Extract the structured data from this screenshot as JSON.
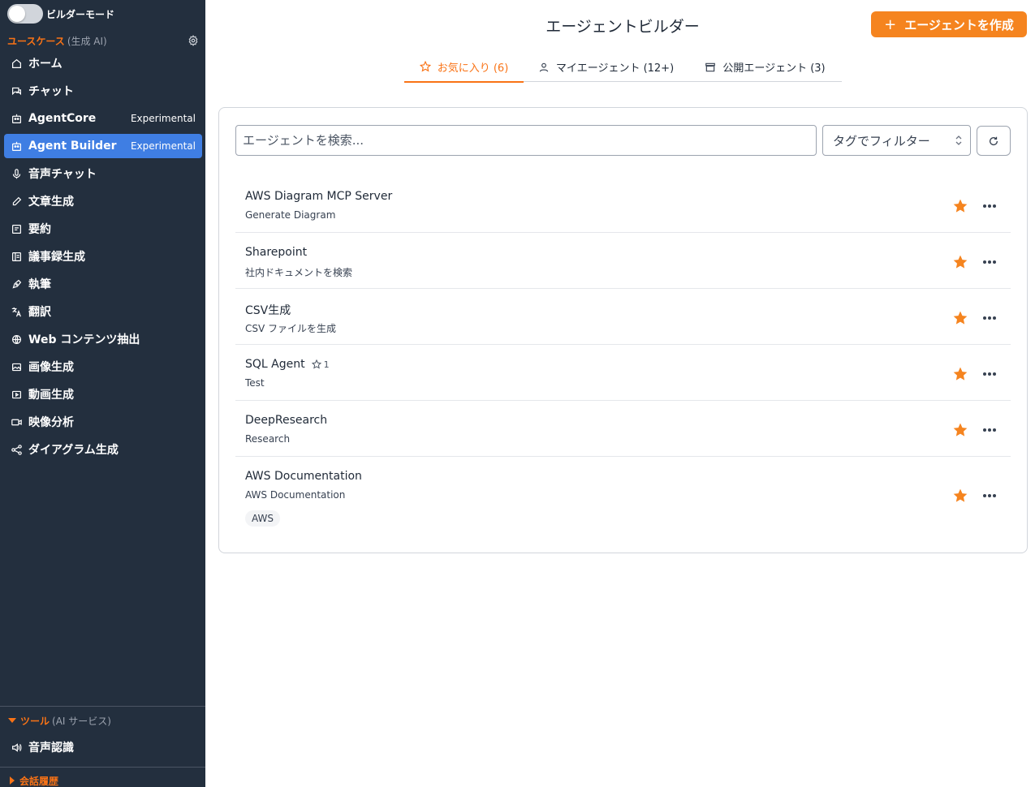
{
  "sidebar": {
    "builder_mode_label": "ビルダーモード",
    "usecase_title": "ユースケース",
    "usecase_sub": "(生成 AI)",
    "items": [
      {
        "label": "ホーム",
        "icon": "home-icon",
        "badge": ""
      },
      {
        "label": "チャット",
        "icon": "chat-icon",
        "badge": ""
      },
      {
        "label": "AgentCore",
        "icon": "robot-icon",
        "badge": "Experimental"
      },
      {
        "label": "Agent Builder",
        "icon": "robot-icon",
        "badge": "Experimental"
      },
      {
        "label": "音声チャット",
        "icon": "microphone-icon",
        "badge": ""
      },
      {
        "label": "文章生成",
        "icon": "pencil-icon",
        "badge": ""
      },
      {
        "label": "要約",
        "icon": "summary-icon",
        "badge": ""
      },
      {
        "label": "議事録生成",
        "icon": "minutes-icon",
        "badge": ""
      },
      {
        "label": "執筆",
        "icon": "pen-icon",
        "badge": ""
      },
      {
        "label": "翻訳",
        "icon": "translate-icon",
        "badge": ""
      },
      {
        "label": "Web コンテンツ抽出",
        "icon": "globe-icon",
        "badge": ""
      },
      {
        "label": "画像生成",
        "icon": "image-icon",
        "badge": ""
      },
      {
        "label": "動画生成",
        "icon": "video-play-icon",
        "badge": ""
      },
      {
        "label": "映像分析",
        "icon": "camera-icon",
        "badge": ""
      },
      {
        "label": "ダイアグラム生成",
        "icon": "diagram-icon",
        "badge": ""
      }
    ],
    "tools_title": "ツール",
    "tools_sub": "(AI サービス)",
    "tools_items": [
      {
        "label": "音声認識",
        "icon": "speaker-icon"
      }
    ],
    "history_title": "会話履歴"
  },
  "header": {
    "title": "エージェントビルダー",
    "create_label": "エージェントを作成"
  },
  "tabs": [
    {
      "label": "お気に入り (6)",
      "icon": "star-outline-icon"
    },
    {
      "label": "マイエージェント (12+)",
      "icon": "user-icon"
    },
    {
      "label": "公開エージェント (3)",
      "icon": "store-icon"
    }
  ],
  "search": {
    "placeholder": "エージェントを検索...",
    "value": ""
  },
  "filter": {
    "selected": "タグでフィルター"
  },
  "agents": [
    {
      "name": "AWS Diagram MCP Server",
      "description": "Generate Diagram",
      "stars": "",
      "tag": ""
    },
    {
      "name": "Sharepoint",
      "description": "社内ドキュメントを検索",
      "stars": "",
      "tag": ""
    },
    {
      "name": "CSV生成",
      "description": "CSV ファイルを生成",
      "stars": "",
      "tag": ""
    },
    {
      "name": "SQL Agent",
      "description": "Test",
      "stars": "1",
      "tag": ""
    },
    {
      "name": "DeepResearch",
      "description": "Research",
      "stars": "",
      "tag": ""
    },
    {
      "name": "AWS Documentation",
      "description": "AWS Documentation",
      "stars": "",
      "tag": "AWS"
    }
  ],
  "colors": {
    "sidebar_bg": "#232f3e",
    "accent": "#f97316",
    "active_nav": "#3f7ee3",
    "button": "#f5841f"
  }
}
